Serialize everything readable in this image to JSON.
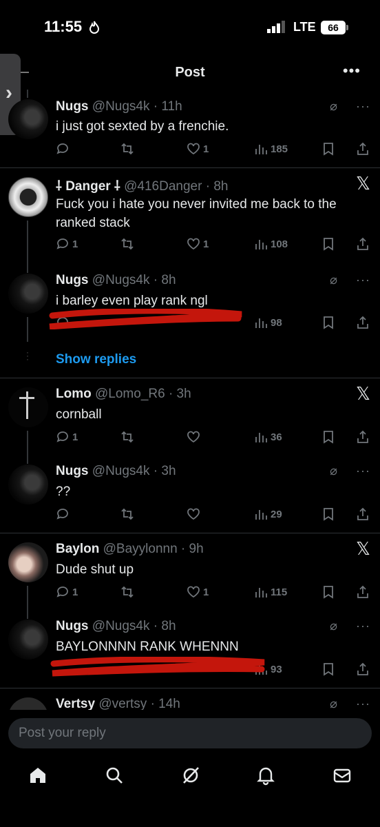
{
  "status_bar": {
    "time": "11:55",
    "network": "LTE",
    "battery": "66"
  },
  "header": {
    "title": "Post",
    "more_label": "•••"
  },
  "tweets": [
    {
      "name": "Nugs",
      "handle": "@Nugs4k · 11h",
      "text": "i just got sexted by a frenchie.",
      "replies": "",
      "reposts": "",
      "likes": "1",
      "views": "185"
    },
    {
      "name": "⸸ Danger ⸸",
      "handle": "@416Danger · 8h",
      "text": "Fuck you i hate you never invited me back to the ranked stack",
      "replies": "1",
      "reposts": "",
      "likes": "1",
      "views": "108"
    },
    {
      "name": "Nugs",
      "handle": "@Nugs4k · 8h",
      "text": "i barley even play rank ngl",
      "replies": "",
      "reposts": "",
      "likes": "",
      "views": "98"
    },
    {
      "name": "Lomo",
      "handle": "@Lomo_R6 · 3h",
      "text": "cornball",
      "replies": "1",
      "reposts": "",
      "likes": "",
      "views": "36"
    },
    {
      "name": "Nugs",
      "handle": "@Nugs4k · 3h",
      "text": "??",
      "replies": "",
      "reposts": "",
      "likes": "",
      "views": "29"
    },
    {
      "name": "Baylon",
      "handle": "@Bayylonnn · 9h",
      "text": "Dude shut up",
      "replies": "1",
      "reposts": "",
      "likes": "1",
      "views": "115"
    },
    {
      "name": "Nugs",
      "handle": "@Nugs4k · 8h",
      "text": "BAYLONNNN RANK WHENNN",
      "replies": "",
      "reposts": "",
      "likes": "",
      "views": "93"
    },
    {
      "name": "Vertsy",
      "handle": "@vertsy · 14h",
      "text": "",
      "replies": "",
      "reposts": "",
      "likes": "",
      "views": ""
    }
  ],
  "show_replies": "Show replies",
  "reply_placeholder": "Post your reply",
  "icons": {
    "grok": "grok-icon",
    "more": "more-icon",
    "x_logo": "x-logo-icon",
    "nav": [
      "home-icon",
      "search-icon",
      "grok-icon",
      "notifications-icon",
      "messages-icon"
    ]
  },
  "colors": {
    "accent": "#1d9bf0",
    "background": "#000000",
    "muted": "#71767b",
    "scribble": "#c4160c"
  }
}
